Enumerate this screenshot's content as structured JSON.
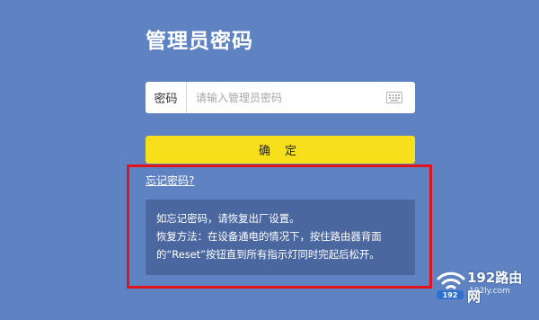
{
  "login": {
    "title": "管理员密码",
    "password_label": "密码",
    "password_placeholder": "请输入管理员密码",
    "password_value": "",
    "keyboard_icon": "keyboard-icon",
    "confirm_label": "确定",
    "forgot_link": "忘记密码?"
  },
  "tip": {
    "line1": "如忘记密码，请恢复出厂设置。",
    "line2": "恢复方法：在设备通电的情况下，按住路由器背面",
    "line3": "的“Reset”按钮直到所有指示灯同时完起后松开。"
  },
  "watermark": {
    "brand": "192路由网",
    "url": "192ly.com",
    "logo_text": "192"
  },
  "colors": {
    "background": "#5f83c2",
    "confirm_button": "#f7e01b",
    "tip_background": "#4a67a0",
    "highlight_frame": "#e0141b"
  }
}
